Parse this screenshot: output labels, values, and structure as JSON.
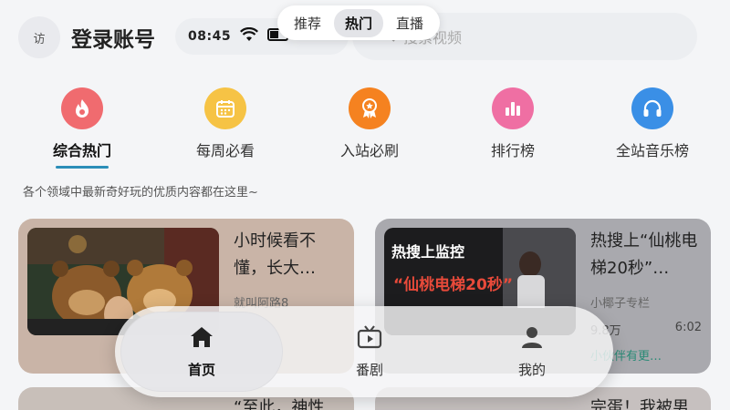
{
  "header": {
    "avatar_text": "访",
    "login_title": "登录账号",
    "status_time": "08:45",
    "search_placeholder": "搜索视频"
  },
  "top_tabs": [
    {
      "label": "推荐",
      "active": false
    },
    {
      "label": "热门",
      "active": true
    },
    {
      "label": "直播",
      "active": false
    }
  ],
  "categories": [
    {
      "label": "综合热门",
      "icon": "flame-icon",
      "color": "#f06b6f",
      "active": true
    },
    {
      "label": "每周必看",
      "icon": "calendar-icon",
      "color": "#f6c345",
      "active": false
    },
    {
      "label": "入站必刷",
      "icon": "badge-icon",
      "color": "#f58220",
      "active": false
    },
    {
      "label": "排行榜",
      "icon": "bar-chart-icon",
      "color": "#ef6fa3",
      "active": false
    },
    {
      "label": "全站音乐榜",
      "icon": "headphones-icon",
      "color": "#3a8fe6",
      "active": false
    }
  ],
  "description": "各个领域中最新奇好玩的优质内容都在这里~",
  "videos": [
    {
      "title": "小时候看不懂，长大…",
      "author": "就叫阿路8",
      "views": "",
      "duration": "",
      "comment": ""
    },
    {
      "title": "热搜上“仙桃电梯20秒”…",
      "author": "小椰子专栏",
      "views": "9.8万",
      "duration": "6:02",
      "comment": "小伙伴有更…",
      "thumb_overlay_top": "热搜上监控",
      "thumb_overlay_bottom": "“仙桃电梯20秒”"
    }
  ],
  "next_videos": [
    {
      "title": "“至此，神性"
    },
    {
      "title": "完蛋！我被男"
    }
  ],
  "bottom_nav": [
    {
      "label": "首页",
      "icon": "home-icon",
      "active": true
    },
    {
      "label": "番剧",
      "icon": "tv-icon",
      "active": false
    },
    {
      "label": "我的",
      "icon": "user-icon",
      "active": false
    }
  ],
  "colors": {
    "accent": "#2b8eb8",
    "comment": "#2a8a76"
  }
}
